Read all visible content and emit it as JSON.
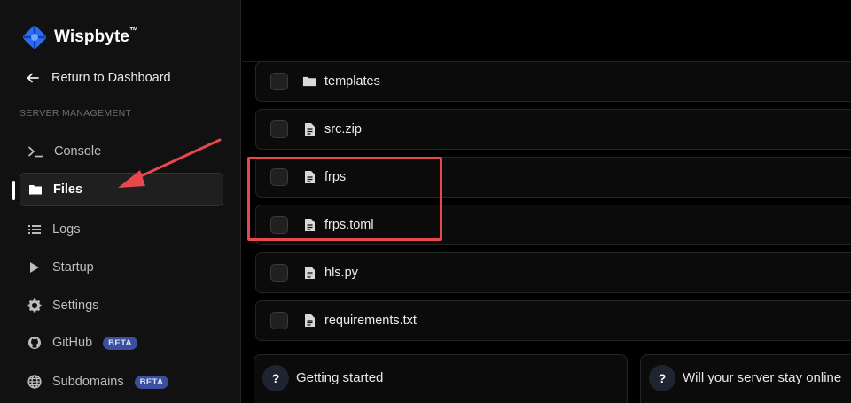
{
  "brand": {
    "name": "Wispbyte",
    "trademark": "™"
  },
  "nav": {
    "return_label": "Return to Dashboard",
    "section_label": "SERVER MANAGEMENT",
    "items": [
      {
        "label": "Console",
        "icon": "terminal-icon"
      },
      {
        "label": "Files",
        "icon": "folder-icon",
        "active": true
      },
      {
        "label": "Logs",
        "icon": "list-icon"
      },
      {
        "label": "Startup",
        "icon": "play-icon"
      },
      {
        "label": "Settings",
        "icon": "gear-icon"
      },
      {
        "label": "GitHub",
        "icon": "github-icon",
        "badge": "BETA"
      },
      {
        "label": "Subdomains",
        "icon": "globe-icon",
        "badge": "BETA"
      }
    ]
  },
  "files": [
    {
      "name": "templates",
      "type": "folder"
    },
    {
      "name": "src.zip",
      "type": "file"
    },
    {
      "name": "frps",
      "type": "file"
    },
    {
      "name": "frps.toml",
      "type": "file"
    },
    {
      "name": "hls.py",
      "type": "file"
    },
    {
      "name": "requirements.txt",
      "type": "file"
    }
  ],
  "cards": [
    {
      "title": "Getting started",
      "icon": "?"
    },
    {
      "title": "Will your server stay online",
      "icon": "?"
    }
  ],
  "colors": {
    "sidebar_bg": "#111111",
    "accent_badge": "#3b4f9e",
    "highlight": "#e5484d",
    "logo": "#2b6cf0"
  }
}
